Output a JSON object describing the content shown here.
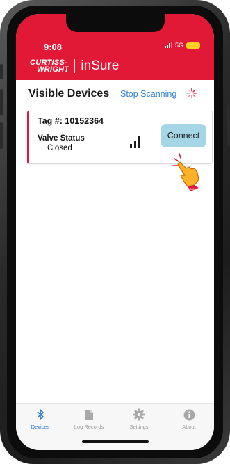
{
  "status_bar": {
    "time": "9:08",
    "network": "5G"
  },
  "header": {
    "logo_line1": "CURTISS-",
    "logo_line2": "WRIGHT",
    "app_name": "inSure",
    "color": "#e21837"
  },
  "page": {
    "title": "Visible Devices",
    "stop_scanning": "Stop Scanning"
  },
  "device": {
    "tag_label": "Tag #:",
    "tag_number": "10152364",
    "valve_status_label": "Valve Status",
    "valve_status_value": "Closed",
    "signal_level": 3,
    "connect_label": "Connect",
    "hand_hint": "Click Me"
  },
  "tabs": [
    {
      "label": "Devices",
      "icon": "bluetooth-icon",
      "active": true
    },
    {
      "label": "Log Records",
      "icon": "document-icon",
      "active": false
    },
    {
      "label": "Settings",
      "icon": "gear-icon",
      "active": false
    },
    {
      "label": "About",
      "icon": "info-icon",
      "active": false
    }
  ],
  "colors": {
    "accent": "#2f7fcf",
    "connect_button": "#a5d6e6",
    "brand_red": "#e21837"
  }
}
